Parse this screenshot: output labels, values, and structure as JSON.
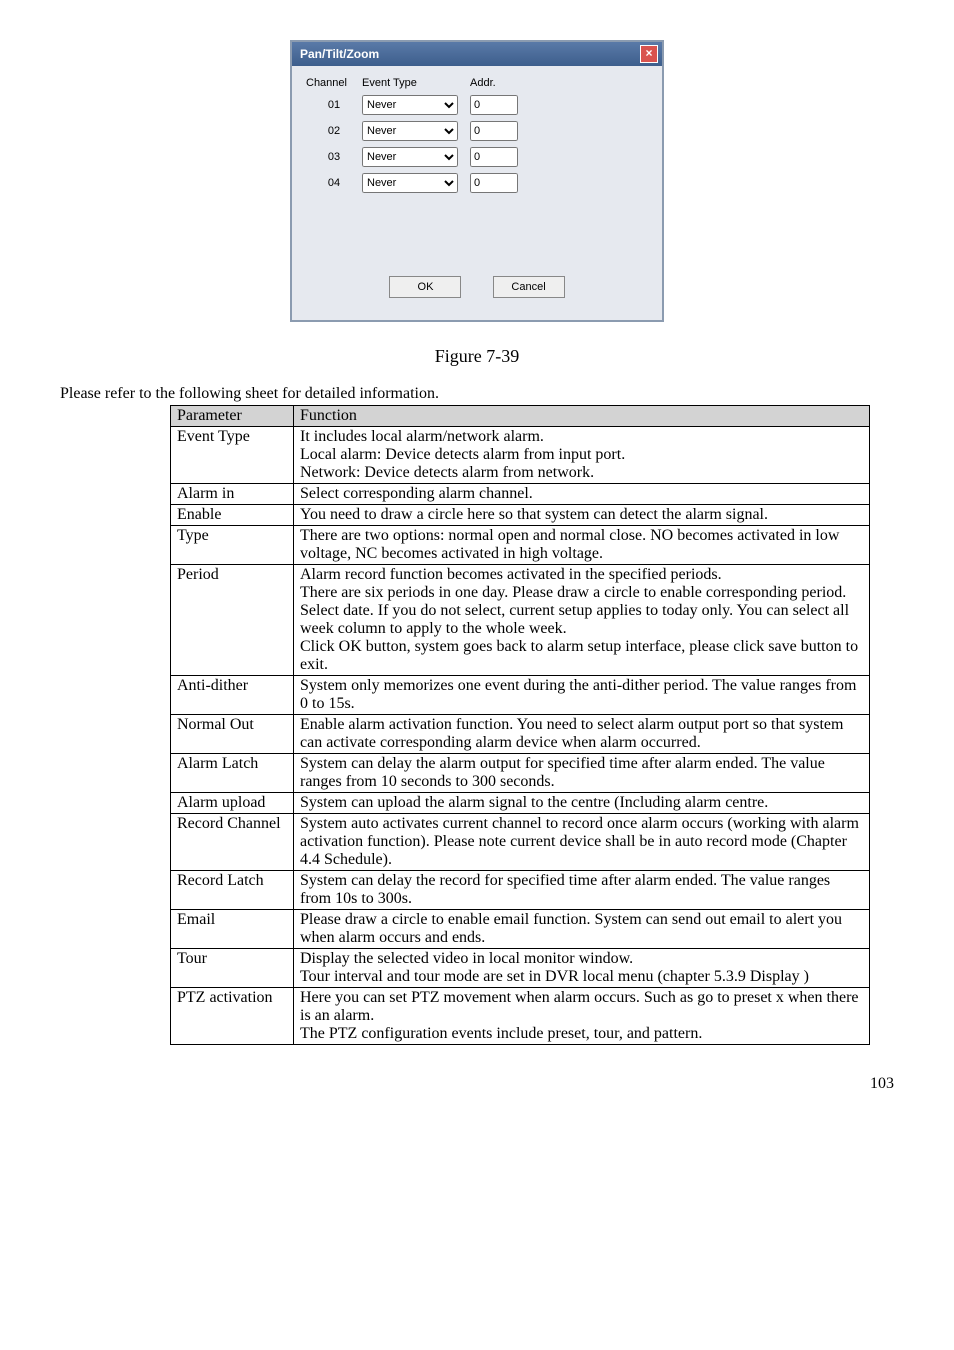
{
  "dialog": {
    "title": "Pan/Tilt/Zoom",
    "close_label": "×",
    "headers": {
      "channel": "Channel",
      "event": "Event Type",
      "addr": "Addr."
    },
    "rows": [
      {
        "channel": "01",
        "event": "Never",
        "addr": "0"
      },
      {
        "channel": "02",
        "event": "Never",
        "addr": "0"
      },
      {
        "channel": "03",
        "event": "Never",
        "addr": "0"
      },
      {
        "channel": "04",
        "event": "Never",
        "addr": "0"
      }
    ],
    "ok": "OK",
    "cancel": "Cancel"
  },
  "figure_caption": "Figure 7-39",
  "intro": "Please refer to the following sheet for detailed information.",
  "table": {
    "headers": {
      "param": "Parameter",
      "func": "Function"
    },
    "rows": [
      {
        "param": "Event Type",
        "func": "It includes local alarm/network alarm.\nLocal alarm: Device detects alarm from input port.\nNetwork: Device detects alarm from network."
      },
      {
        "param": "Alarm in",
        "func": "Select corresponding alarm channel."
      },
      {
        "param": "Enable",
        "func": "You need to draw a circle here so that system can detect the alarm signal."
      },
      {
        "param": "Type",
        "func": "There are two options: normal open and normal close. NO becomes activated in low voltage, NC becomes activated in high voltage."
      },
      {
        "param": "Period",
        "func": "Alarm record function becomes activated in the specified periods.\nThere are six periods in one day. Please draw a circle to enable corresponding period.\nSelect date. If you do not select, current setup applies to today only. You can select all week column to apply to the whole week.\nClick OK button, system goes back to alarm setup interface, please click save button to exit."
      },
      {
        "param": "Anti-dither",
        "func": "System only memorizes one event during the anti-dither period. The value ranges from 0 to 15s."
      },
      {
        "param": "Normal Out",
        "func": "Enable alarm activation function. You need to select alarm output port so that system can activate corresponding alarm device when alarm occurred."
      },
      {
        "param": "Alarm Latch",
        "func": "System can delay the alarm output for specified time after alarm ended. The value ranges from 10 seconds to 300 seconds."
      },
      {
        "param": "Alarm upload",
        "func": "System can upload the alarm signal to the centre (Including alarm centre."
      },
      {
        "param": "Record Channel",
        "func": "System auto activates current channel to record once alarm occurs (working with alarm activation function). Please note current device shall be in auto record mode (Chapter 4.4 Schedule)."
      },
      {
        "param": "Record Latch",
        "func": "System can delay the record for specified time after alarm ended. The value ranges from 10s to 300s."
      },
      {
        "param": "Email",
        "func": "Please draw a circle to enable email function. System can send out email to alert you when alarm occurs and ends."
      },
      {
        "param": "Tour",
        "func": "Display the selected video in local monitor window.\nTour interval and tour mode are set in DVR local menu (chapter 5.3.9 Display )"
      },
      {
        "param": "PTZ activation",
        "func": "Here you can set PTZ movement when alarm occurs. Such as go to preset x when there is an alarm.\nThe PTZ configuration events include preset, tour, and pattern."
      }
    ]
  },
  "page_number": "103"
}
